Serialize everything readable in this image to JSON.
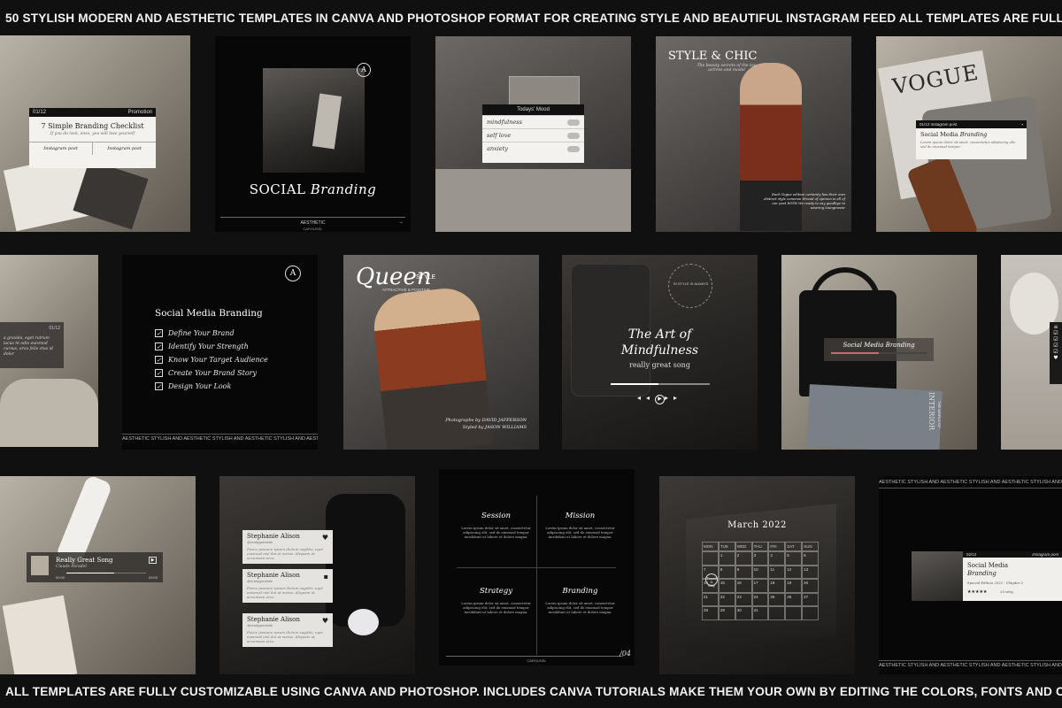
{
  "banner": {
    "top": "50 STYLISH  MODERN AND  AESTHETIC TEMPLATES  IN CANVA AND PHOTOSHOP FORMAT FOR CREATING STYLE AND BEAUTIFUL INSTAGRAM FEED  ALL TEMPLATES ARE FULLY CUSTOMIZA",
    "bottom": "ALL TEMPLATES ARE FULLY CUSTOMIZABLE USING CANVA AND PHOTOSHOP. INCLUDES CANVA TUTORIALS  MAKE THEM YOUR OWN BY EDITING THE COLORS, FONTS AND COLORS.  PHOT"
  },
  "t1": {
    "page": "01/12",
    "tag": "Promotion",
    "title": "7 Simple Branding Checklist",
    "sub": "If you do look, ense, you will lose yourself",
    "btn1": "Instagram post",
    "btn2": "Instagram post"
  },
  "t2": {
    "logo": "A",
    "title_a": "SOCIAL ",
    "title_b": "Branding",
    "footer": "AESTHETIC",
    "sub": "CAROUSEL"
  },
  "t3": {
    "title": "Todays' Mood",
    "rows": [
      "mindfulness",
      "self love",
      "anxiety"
    ]
  },
  "t4": {
    "title": "STYLE & CHIC",
    "sub": "The beauty secrets of the top actress and model",
    "body": "Each Vogue edition certainly has their own distinct style common thread of opinion is all of our post WITH We ready to say goodbye to wearing loungewear"
  },
  "t5": {
    "magazine": "VOGUE",
    "hdr": "01/12  Instagram post",
    "title": "Social Media ",
    "title_i": "Branding",
    "body": "Lorem ipsum dolor sit amet, consectetur adipiscing elit, sed do eiusmod tempor"
  },
  "t6": {
    "page": "01/12",
    "body": "a gravida, eget rutrum lacus nt odio euismod cursus, arcu felis ctus id dolor"
  },
  "t7": {
    "logo": "A",
    "title": "Social Media Branding",
    "items": [
      "Define Your Brand",
      "Identify Your Strength",
      "Know Your Target Audience",
      "Create Your Brand Story",
      "Design Your Look"
    ],
    "ticker": "AESTHETIC STYLISH AND   AESTHETIC STYLISH AND   AESTHETIC STYLISH AND   AESTHETIC STYLISH A"
  },
  "t8": {
    "title": "Queen",
    "style": "STYLE",
    "sub": "ATTRACTIVE & POSITIVE",
    "credit1": "Photographs by DAVID JAFFERSON",
    "credit2": "Styled by JASON WILLIAMS"
  },
  "t9": {
    "circle": "IN STYLE IS ALWAYS",
    "title1": "The Art of",
    "title2": "Mindfulness",
    "sub": "really great song"
  },
  "t10": {
    "title": "Social Media Branding",
    "mag": "INTERIOR",
    "mag2": "THE WORLD OF"
  },
  "t12": {
    "title": "Really Great Song",
    "artist": "Claude Paradel",
    "t1": "00:00",
    "t2": "03:00"
  },
  "t13": {
    "posts": [
      {
        "name": "Stephanie Alison",
        "handle": "@reallygreatsite",
        "text": "Fusce posuere ipsum dictum sagittis, eget euismod nisl dui at metus. Aliquam at accumsan arcu."
      },
      {
        "name": "Stephanie Alison",
        "handle": "@reallygreatsite",
        "text": "Fusce posuere ipsum dictum sagittis, eget euismod nisl dui at metus. Aliquam at accumsan arcu."
      },
      {
        "name": "Stephanie Alison",
        "handle": "@reallygreatsite",
        "text": "Fusce posuere ipsum dictum sagittis, eget euismod nisl dui at metus. Aliquam at accumsan arcu."
      }
    ]
  },
  "t14": {
    "quads": [
      {
        "title": "Session",
        "body": "Lorem ipsum dolor sit amet, consectetur adipiscing elit, sed do eiusmod tempor incididunt ut labore et dolore magna."
      },
      {
        "title": "Mission",
        "body": "Lorem ipsum dolor sit amet, consectetur adipiscing elit, sed do eiusmod tempor incididunt ut labore et dolore magna."
      },
      {
        "title": "Strategy",
        "body": "Lorem ipsum dolor sit amet, consectetur adipiscing elit, sed do eiusmod tempor incididunt ut labore et dolore magna."
      },
      {
        "title": "Branding",
        "body": "Lorem ipsum dolor sit amet, consectetur adipiscing elit, sed do eiusmod tempor incididunt ut labore et dolore magna."
      }
    ],
    "page": "/04",
    "footer": "CAROUSEL"
  },
  "t15": {
    "title": "March 2022",
    "days": [
      "MON",
      "TUE",
      "WED",
      "THU",
      "FRI",
      "SAT",
      "SUN"
    ],
    "note": "Travel & Stay",
    "nums": [
      "",
      "1",
      "2",
      "3",
      "4",
      "5",
      "6",
      "7",
      "8",
      "9",
      "10",
      "11",
      "12",
      "13",
      "14",
      "15",
      "16",
      "17",
      "18",
      "19",
      "20",
      "21",
      "22",
      "23",
      "24",
      "25",
      "26",
      "27",
      "28",
      "29",
      "30",
      "31",
      "",
      "",
      ""
    ]
  },
  "t16": {
    "ticker": "AESTHETIC STYLISH AND   AESTHETIC STYLISH AND   AESTHETIC STYLISH AND   AESTHETIC STYLISH AND",
    "page": "02/12",
    "tag": "Instagram post",
    "title": "Social Media ",
    "title_i": "Branding",
    "sub": "Special Edition 2022 - Chapter 2",
    "stars": "★★★★★",
    "rating": "4.5 rating"
  }
}
